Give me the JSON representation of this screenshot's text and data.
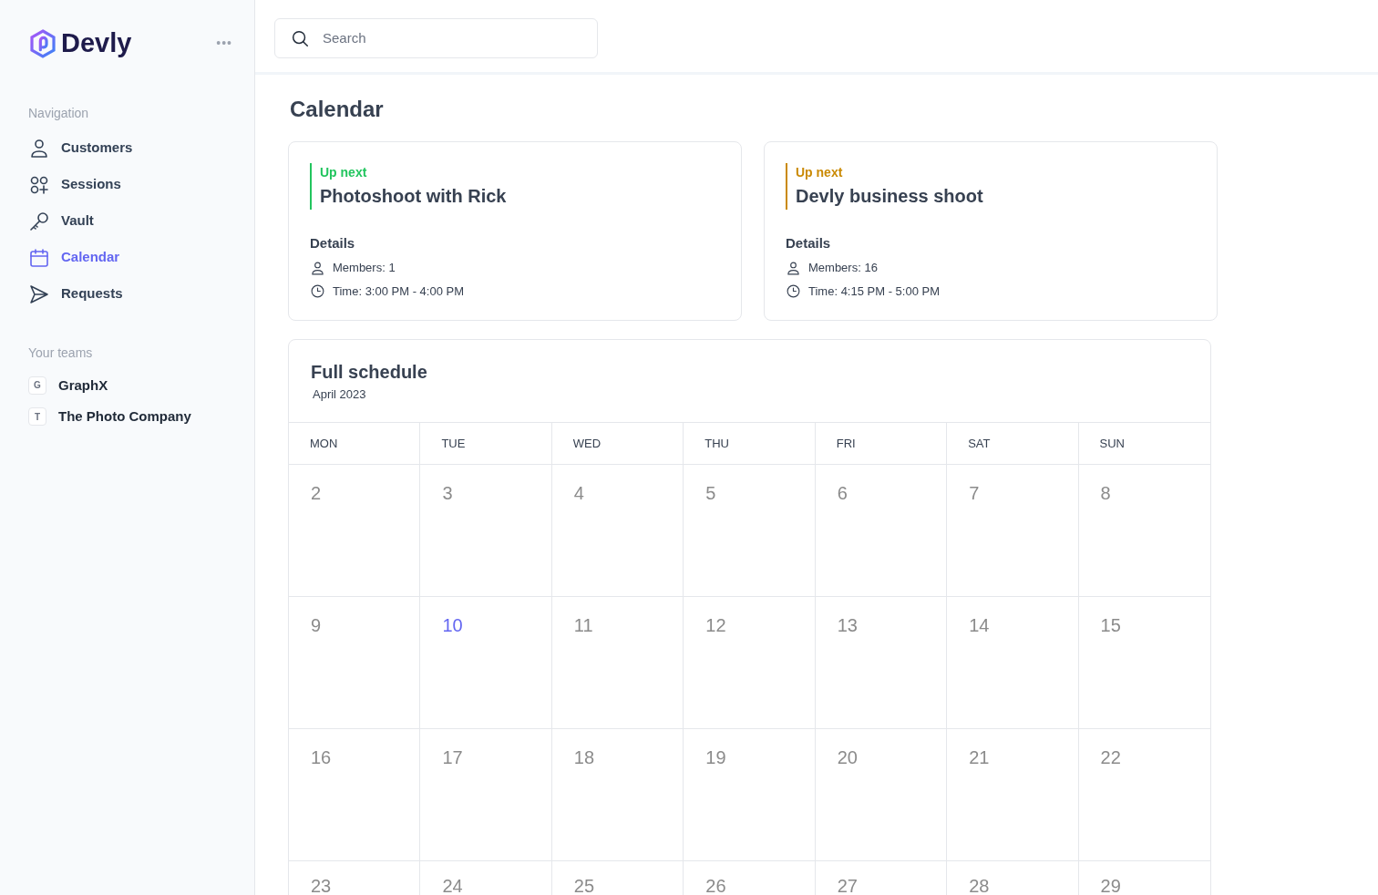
{
  "sidebar": {
    "logo": "Devly",
    "more": "•••",
    "sections": [
      {
        "heading": "Navigation",
        "kind": "nav",
        "items": [
          {
            "label": "Customers",
            "selected": false
          },
          {
            "label": "Sessions",
            "selected": false
          },
          {
            "label": "Vault",
            "selected": false
          },
          {
            "label": "Calendar",
            "selected": true
          },
          {
            "label": "Requests",
            "selected": false
          }
        ]
      },
      {
        "heading": "Your teams",
        "kind": "teams",
        "items": [
          {
            "label": "GraphX",
            "initial": "G",
            "selected": false
          },
          {
            "label": "The Photo Company",
            "initial": "T",
            "selected": false
          }
        ]
      }
    ]
  },
  "search": {
    "placeholder": "Search"
  },
  "page_title": "Calendar",
  "upcoming": [
    {
      "eyebrow": "Up next",
      "title": "Photoshoot with Rick",
      "color": "#22c55e",
      "details_heading": "Details",
      "members": "Members: 1",
      "time": "Time: 3:00 PM - 4:00 PM"
    },
    {
      "eyebrow": "Up next",
      "title": "Devly business shoot",
      "color": "#ca8a04",
      "details_heading": "Details",
      "members": "Members: 16",
      "time": "Time: 4:15 PM - 5:00 PM"
    }
  ],
  "schedule": {
    "title": "Full schedule",
    "subtitle": "April 2023",
    "weekdays": [
      "MON",
      "TUE",
      "WED",
      "THU",
      "FRI",
      "SAT",
      "SUN"
    ],
    "weeks": [
      [
        {
          "day": "2",
          "selected": false
        },
        {
          "day": "3",
          "selected": false
        },
        {
          "day": "4",
          "selected": false
        },
        {
          "day": "5",
          "selected": false
        },
        {
          "day": "6",
          "selected": false
        },
        {
          "day": "7",
          "selected": false
        },
        {
          "day": "8",
          "selected": false
        }
      ],
      [
        {
          "day": "9",
          "selected": false
        },
        {
          "day": "10",
          "selected": true
        },
        {
          "day": "11",
          "selected": false
        },
        {
          "day": "12",
          "selected": false
        },
        {
          "day": "13",
          "selected": false
        },
        {
          "day": "14",
          "selected": false
        },
        {
          "day": "15",
          "selected": false
        }
      ],
      [
        {
          "day": "16",
          "selected": false
        },
        {
          "day": "17",
          "selected": false
        },
        {
          "day": "18",
          "selected": false
        },
        {
          "day": "19",
          "selected": false
        },
        {
          "day": "20",
          "selected": false
        },
        {
          "day": "21",
          "selected": false
        },
        {
          "day": "22",
          "selected": false
        }
      ],
      [
        {
          "day": "23",
          "selected": false
        },
        {
          "day": "24",
          "selected": false
        },
        {
          "day": "25",
          "selected": false
        },
        {
          "day": "26",
          "selected": false
        },
        {
          "day": "27",
          "selected": false
        },
        {
          "day": "28",
          "selected": false
        },
        {
          "day": "29",
          "selected": false
        }
      ]
    ]
  }
}
